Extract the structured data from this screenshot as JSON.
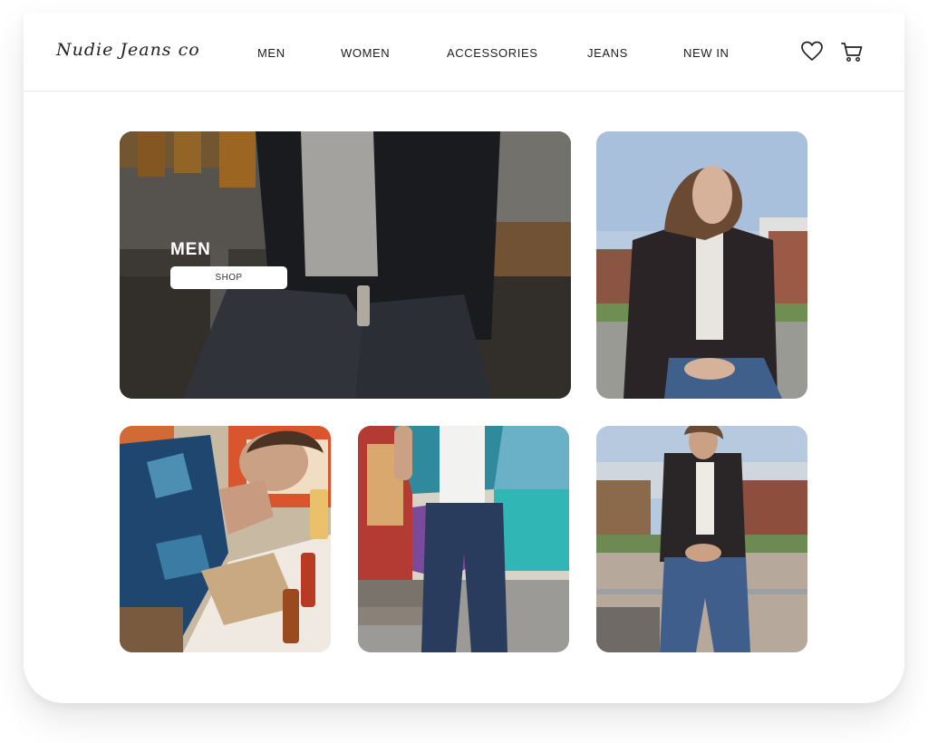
{
  "header": {
    "logo_text": "Nudie Jeans co",
    "nav": [
      "MEN",
      "WOMEN",
      "ACCESSORIES",
      "JEANS",
      "NEW IN"
    ],
    "icons": [
      "heart-icon",
      "shopping-cart-icon"
    ]
  },
  "hero": {
    "title": "MEN",
    "button_label": "SHOP"
  },
  "colors": {
    "background": "#ffffff",
    "text": "#1e1e1e",
    "divider": "#e6e6e6",
    "hero_text": "#ffffff",
    "button_bg": "#ffffff"
  }
}
